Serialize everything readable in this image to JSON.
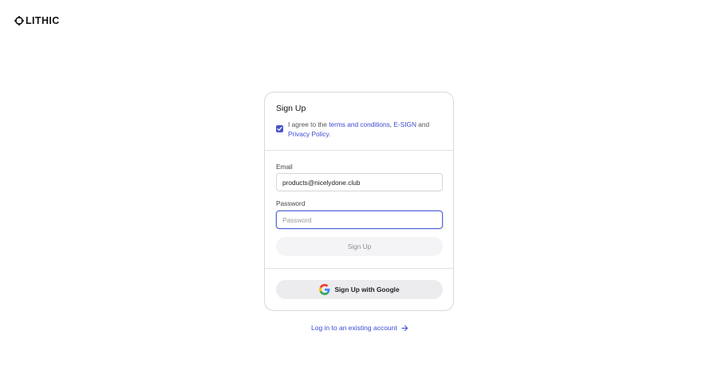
{
  "brand": {
    "name": "LITHIC",
    "logo_icon": "lithic-ring-icon"
  },
  "signup": {
    "title": "Sign Up",
    "agree": {
      "checked": true,
      "prefix": "I agree to the ",
      "terms_link": "terms and conditions",
      "separator": ", ",
      "esign_link": "E-SIGN",
      "and_text": " and ",
      "privacy_link": "Privacy Policy",
      "suffix": "."
    },
    "email": {
      "label": "Email",
      "value": "products@nicelydone.club"
    },
    "password": {
      "label": "Password",
      "placeholder": "Password",
      "value": ""
    },
    "submit_label": "Sign Up",
    "google_label": "Sign Up with Google"
  },
  "login_link": {
    "label": "Log in to an existing account",
    "icon": "arrow-right-icon"
  },
  "colors": {
    "accent": "#4a55c9",
    "link": "#3b4ad4",
    "card_border": "#d9d9de",
    "button_disabled_bg": "#f4f4f6",
    "google_button_bg": "#ececef"
  }
}
